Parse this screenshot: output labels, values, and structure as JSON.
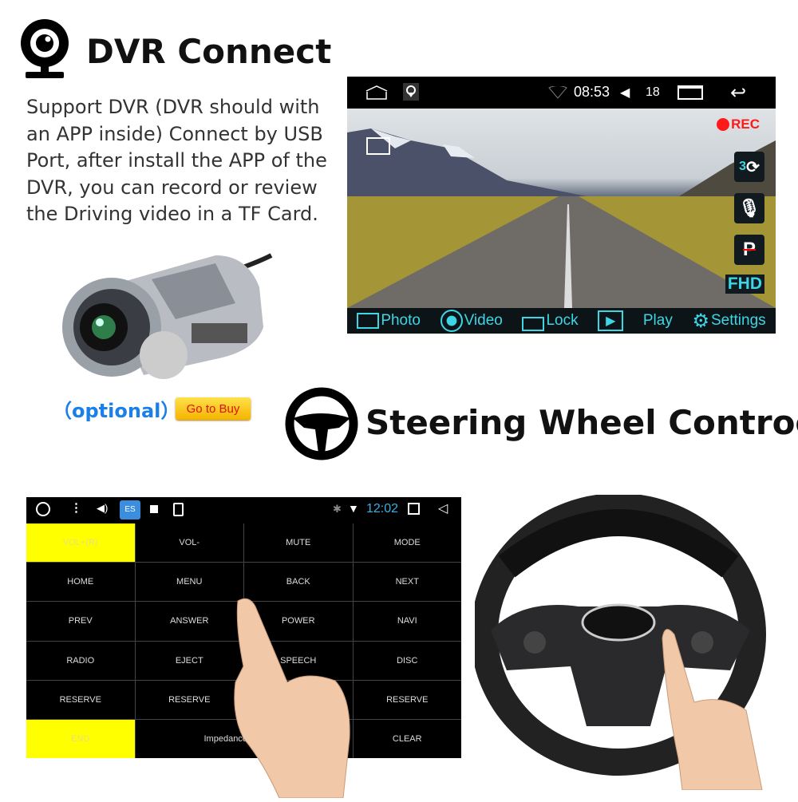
{
  "dvr_section": {
    "title": "DVR Connect",
    "icon": "webcam-icon",
    "description": "Support DVR (DVR should with an APP inside) Connect by USB Port, after install the APP of the DVR, you can record or review the Driving video in a TF Card.",
    "optional_label": "（optional）",
    "buy_button": "Go to Buy",
    "screen": {
      "status": {
        "time": "08:53",
        "volume": "18"
      },
      "rec_label": "REC",
      "side_icons": [
        "loop-record-icon",
        "microphone-icon",
        "parking-off-icon"
      ],
      "side_count": "3",
      "resolution": "FHD",
      "bottom_bar": [
        {
          "label": "Photo",
          "icon": "camera-icon"
        },
        {
          "label": "Video",
          "icon": "video-icon"
        },
        {
          "label": "Lock",
          "icon": "lock-icon"
        },
        {
          "label": "",
          "icon": "play-icon"
        },
        {
          "label": "Play",
          "icon": ""
        },
        {
          "label": "Settings",
          "icon": "gear-icon"
        }
      ],
      "colors": {
        "accent": "#3cd6e4",
        "rec": "#ff1a1a"
      }
    }
  },
  "steering_section": {
    "title": "Steering Wheel Controol",
    "icon": "steering-wheel-icon",
    "screen": {
      "status": {
        "time": "12:02"
      },
      "buttons": [
        [
          "VOL+(R)",
          "VOL-",
          "MUTE",
          "MODE"
        ],
        [
          "HOME",
          "MENU",
          "BACK",
          "NEXT"
        ],
        [
          "PREV",
          "ANSWER",
          "POWER",
          "NAVI"
        ],
        [
          "RADIO",
          "EJECT",
          "SPEECH",
          "DISC"
        ],
        [
          "RESERVE",
          "RESERVE",
          "",
          "RESERVE"
        ]
      ],
      "last_row": {
        "first": "END",
        "middle": "Impedance s",
        "last": "CLEAR"
      },
      "highlight_color": "#ffff00"
    }
  }
}
